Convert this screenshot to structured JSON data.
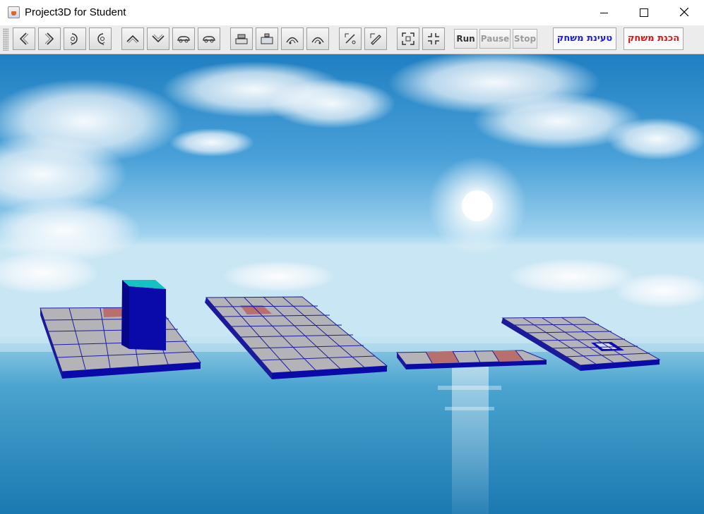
{
  "window": {
    "title": "Project3D for Student",
    "controls": [
      "minimize-icon",
      "maximize-icon",
      "close-icon"
    ]
  },
  "toolbar": {
    "icon_buttons": [
      "arrow-left-icon",
      "arrow-right-icon",
      "rotate-right-icon",
      "rotate-left-icon",
      "chevron-up-icon",
      "chevron-down-icon",
      "car-right-icon",
      "car-left-icon",
      "platform-raise-icon",
      "platform-lower-icon",
      "arc-left-icon",
      "arc-right-icon",
      "diagonal-expand-icon",
      "diagonal-edit-icon",
      "expand-frame-icon",
      "collapse-frame-icon"
    ],
    "run_label": "Run",
    "pause_label": "Pause",
    "stop_label": "Stop",
    "load_game_label": "טעינת משחק",
    "prepare_game_label": "הכנת משחק"
  },
  "colors": {
    "tile_gray": "#b4b4b8",
    "tile_target": "#b8706e",
    "grid_line": "#1c1ca0",
    "board_edge": "#0a0aa8",
    "block_front": "#0a0aaa",
    "block_top": "#13c2c2",
    "hole": "#0b0bb0",
    "load_text": "#1a1ae6",
    "prepare_text": "#e01010"
  }
}
